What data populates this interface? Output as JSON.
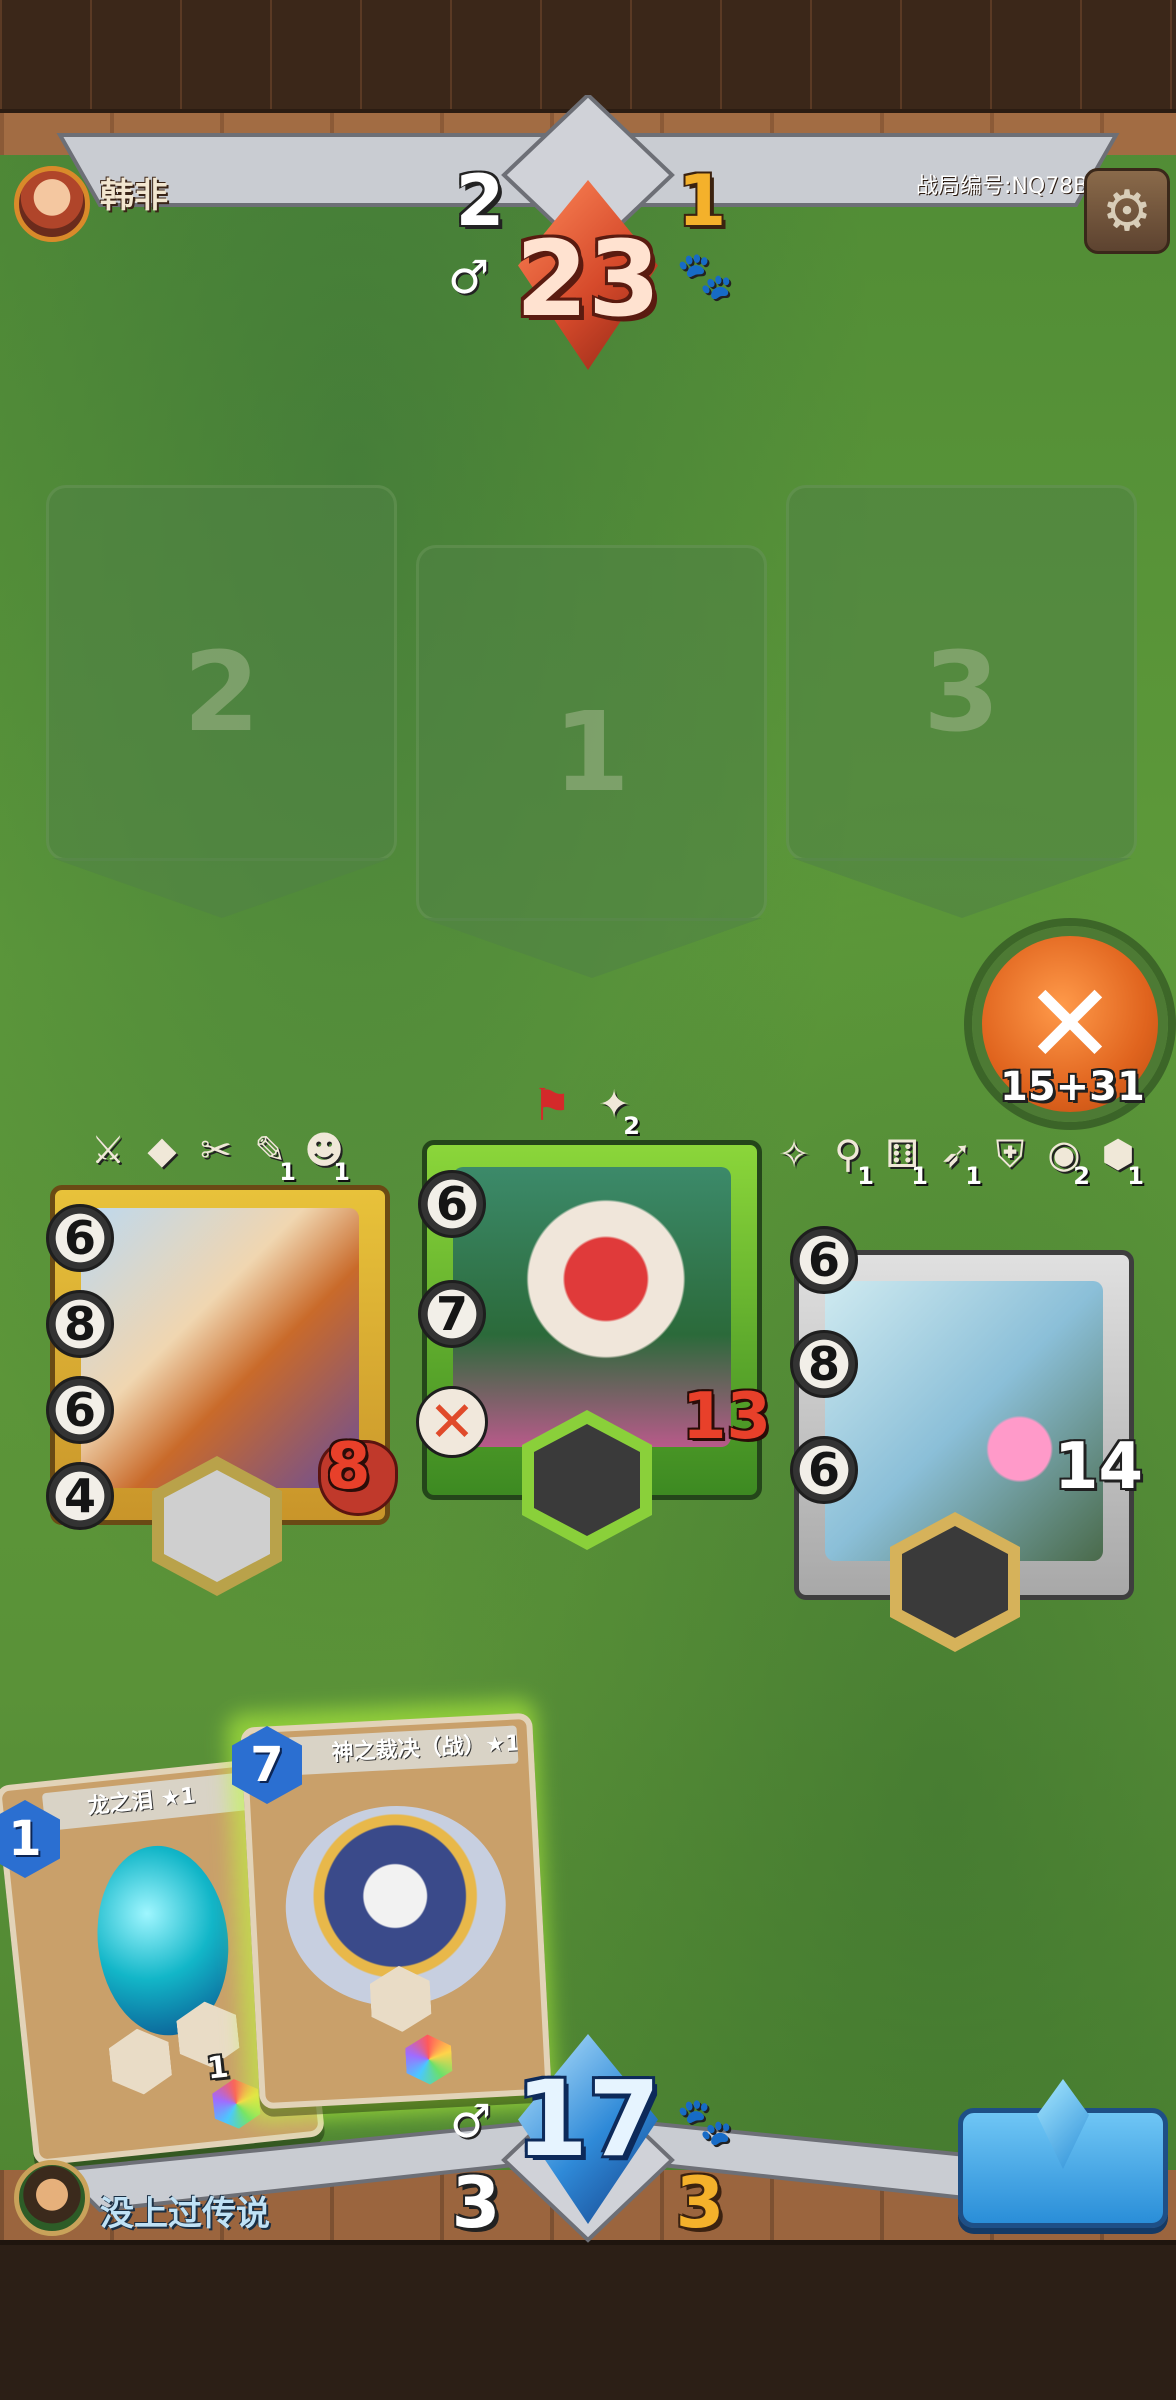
{
  "opponent": {
    "name": "韩非",
    "left_count": "2",
    "right_count": "1",
    "score": "23"
  },
  "battle_id": "战局编号:NQ78B",
  "player": {
    "name": "没上过传说",
    "left_count": "3",
    "right_count": "3",
    "score": "17"
  },
  "lanes": [
    {
      "number": "2"
    },
    {
      "number": "1"
    },
    {
      "number": "3"
    }
  ],
  "fight_button": {
    "label": "15+31",
    "icon": "crossed-swords-icon"
  },
  "board_cards": [
    {
      "stats": [
        "6",
        "8",
        "6",
        "4"
      ],
      "power": "8",
      "buff_counts": [
        "1",
        "1"
      ]
    },
    {
      "stats": [
        "6",
        "7"
      ],
      "power": "13",
      "top_count": "2"
    },
    {
      "stats": [
        "6",
        "8",
        "6"
      ],
      "power": "14",
      "buff_counts": [
        "1",
        "1",
        "1",
        "2",
        "1"
      ]
    }
  ],
  "hand_cards": [
    {
      "name": "龙之泪 ★1",
      "cost": "1",
      "count": "1"
    },
    {
      "name": "神之裁决（战）★1",
      "cost": "7"
    }
  ],
  "colors": {
    "accent_orange": "#e0641e",
    "player_blue": "#2a8ed8",
    "opponent_red": "#d64a2b"
  }
}
